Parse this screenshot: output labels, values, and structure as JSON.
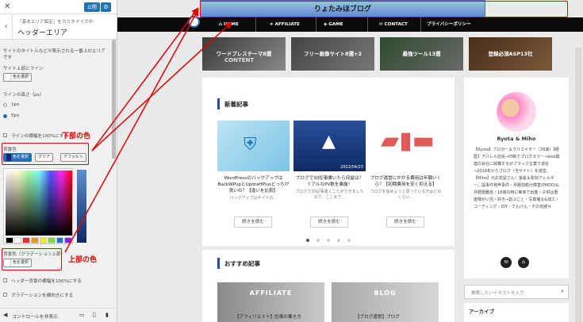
{
  "customizer": {
    "close_icon": "close-icon",
    "publish_label": "公開",
    "breadcrumb": "「基本エリア設定」をカスタマイズ中",
    "section_title": "ヘッダーエリア",
    "description_1": "サイトのタイトルなどが表示される一番上のエリア",
    "description_2": "です",
    "top_line_label": "サイト上部にライン",
    "select_color": "色を選択",
    "line_height_label": "ラインの高さ（px）",
    "radio_1px": "1px",
    "radio_5px": "5px",
    "checkbox_line_full": "ラインの横幅を100%にする",
    "bg_color_label": "背景色",
    "clear_label": "クリア",
    "default_label": "デフォルト",
    "gradient_label": "背景色（グラデーション上部）",
    "checkbox_header_full": "ヘッダー背景の横幅を100%にする",
    "checkbox_gradient": "グラデーションを横向きにする",
    "hide_controls": "コントロールを非表示",
    "palette": [
      "#000000",
      "#ffffff",
      "#dd3333",
      "#dd9933",
      "#eeee22",
      "#81d742",
      "#1e73be",
      "#8224e3"
    ]
  },
  "annotations": {
    "bottom_color": "下部の色",
    "top_color": "上部の色"
  },
  "site": {
    "title": "りょたみほブログ",
    "nav": [
      "HOME",
      "AFFILIATE",
      "GAME",
      "CONTACT",
      "プライバシーポリシー"
    ],
    "banners": [
      "ワードプレステーマ8選",
      "フリー画像サイト8選+2",
      "最強ツール13選",
      "登録必須ASP13社"
    ],
    "banner_subtitle": "CONTENT",
    "new_posts_heading": "新着記事",
    "articles": [
      {
        "title": "WordPressのバックアップはBackWPupとUpdraftPlusどっちが良いの？【違いを比較】",
        "excerpt": "バックアップはサイトの…"
      },
      {
        "title": "ブログで30記事書いたら収益は？リアルなPV数を暴露！",
        "excerpt": "ブログで30記事書くことができましたので、ここまで…",
        "date": "2022/04/23"
      },
      {
        "title": "ブログ運営にかかる費用は年額いくら？【初期費用を安く抑える】",
        "excerpt": "ブログを始めようと思っている方はどのくらい…"
      }
    ],
    "read_more": "続きを読む",
    "recommended_heading": "おすすめ記事",
    "recommended": [
      "AFFILIATE",
      "BLOG"
    ],
    "recommended_captions": [
      "【アフィリエイト】記事の書き方",
      "【ブログ運営】ブログ"
    ],
    "profile": {
      "name": "Ryota & Miho",
      "bio": "【Ryota】ブロガー＆クリエイター（36歳）【経歴】アパレル店員→印刷でプログラマー→web関連の会社に就職するがブラック企業で退社→2019年からブログ（当サイト）を運営。【Miho】元お花屋さん！金属＆彫刻アレルギー。提事件発声事件・月経前痕分障害(PMDD)&月経困難症・18歳の時に実家で出産・子供は重度障がい児・好き→割ぷこと・写真撮る&加工・コーディング・DIY・でんけん・その他諸々"
    },
    "search_placeholder": "検索したいテキストを入力",
    "archive_heading": "アーカイブ"
  },
  "colors": {
    "header_top": "#9fc0e8",
    "header_bottom": "#5e8ccf",
    "accent": "#1e4f9a",
    "annotation": "#e60000"
  }
}
